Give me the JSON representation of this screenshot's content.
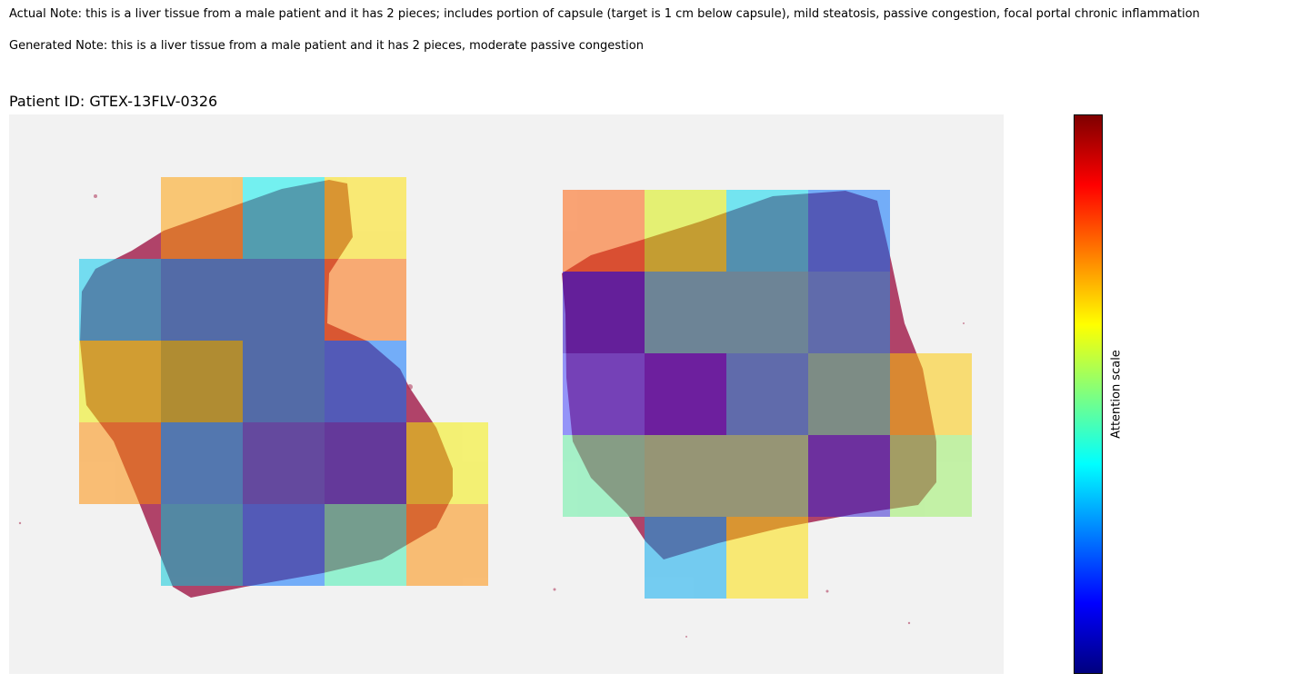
{
  "notes": {
    "actual": "Actual Note: this is a liver tissue from a male patient and it has 2 pieces; includes portion of capsule (target is 1 cm below capsule), mild steatosis, passive congestion, focal portal chronic inflammation",
    "generated": "Generated Note: this is a liver tissue from a male patient and it has 2 pieces, moderate passive congestion"
  },
  "figure": {
    "title": "Patient ID: GTEX-13FLV-0326"
  },
  "colorbar": {
    "label": "Attention scale",
    "colormap": "jet",
    "colors": [
      "#00007f",
      "#0000ff",
      "#007fff",
      "#00ffff",
      "#7fff7f",
      "#ffff00",
      "#ff7f00",
      "#ff0000",
      "#7f0000"
    ]
  },
  "tissue": {
    "stain_color": "#a8305a",
    "background_color": "#f2f2f2"
  }
}
